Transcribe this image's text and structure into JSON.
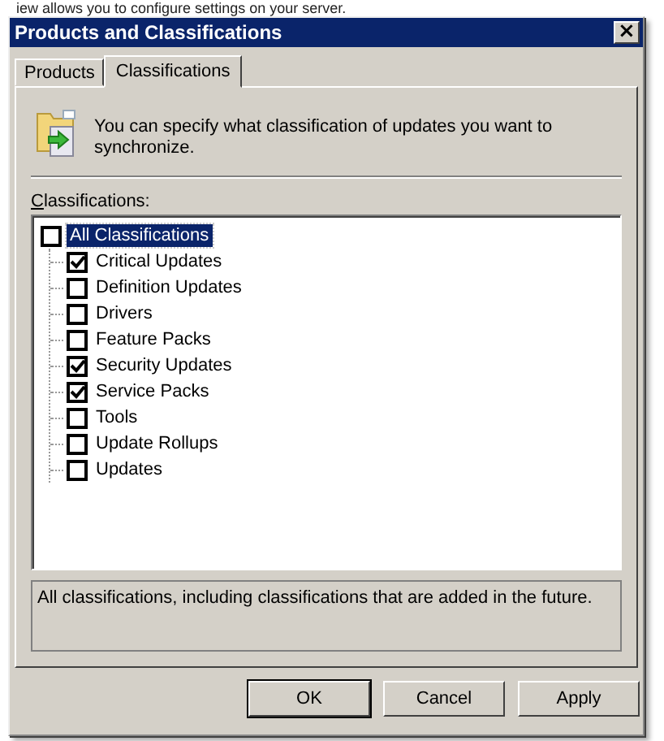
{
  "background": {
    "text": "iew allows you to configure settings on your server."
  },
  "window": {
    "title": "Products and Classifications",
    "close": "×"
  },
  "tabs": [
    {
      "label": "Products",
      "selected": false
    },
    {
      "label": "Classifications",
      "selected": true
    }
  ],
  "intro": "You can specify what classification of updates you want to synchronize.",
  "classifications": {
    "label": "Classifications:",
    "tree": [
      {
        "label": "All Classifications",
        "checked": false,
        "selected": true,
        "children": [
          {
            "label": "Critical Updates",
            "checked": true,
            "selected": false
          },
          {
            "label": "Definition Updates",
            "checked": false,
            "selected": false
          },
          {
            "label": "Drivers",
            "checked": false,
            "selected": false
          },
          {
            "label": "Feature Packs",
            "checked": false,
            "selected": false
          },
          {
            "label": "Security Updates",
            "checked": true,
            "selected": false
          },
          {
            "label": "Service Packs",
            "checked": true,
            "selected": false
          },
          {
            "label": "Tools",
            "checked": false,
            "selected": false
          },
          {
            "label": "Update Rollups",
            "checked": false,
            "selected": false
          },
          {
            "label": "Updates",
            "checked": false,
            "selected": false
          }
        ]
      }
    ]
  },
  "description": "All classifications, including classifications that are added in the future.",
  "buttons": [
    {
      "label": "OK",
      "default": true
    },
    {
      "label": "Cancel",
      "default": false
    },
    {
      "label": "Apply",
      "default": false
    }
  ]
}
